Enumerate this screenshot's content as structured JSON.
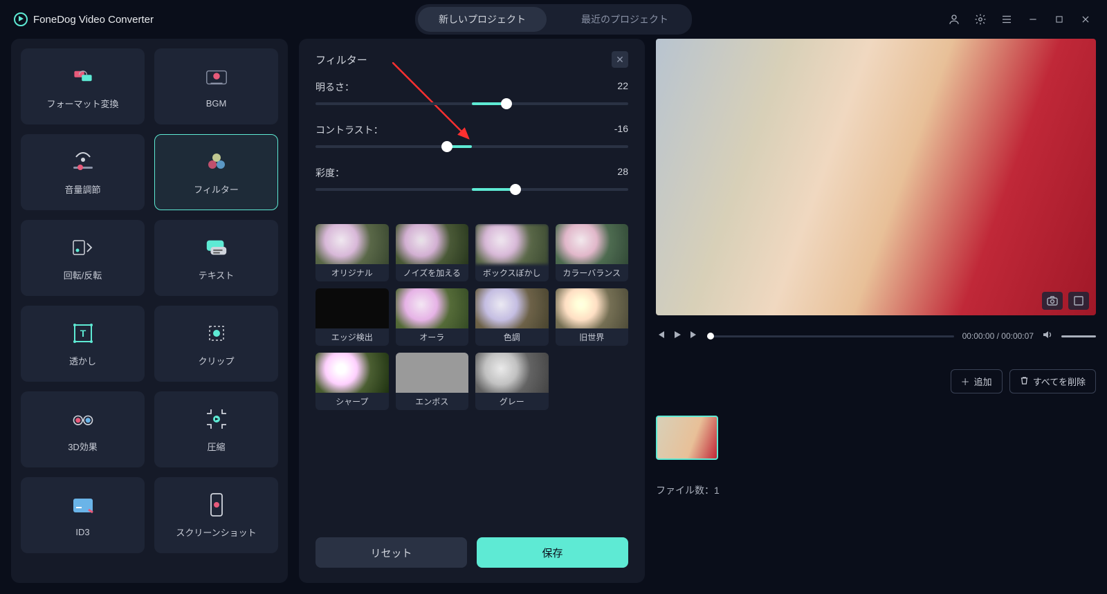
{
  "app": {
    "title": "FoneDog Video Converter"
  },
  "tabs": {
    "new": "新しいプロジェクト",
    "recent": "最近のプロジェクト"
  },
  "sidebar": {
    "items": [
      {
        "label": "フォーマット変換"
      },
      {
        "label": "BGM"
      },
      {
        "label": "音量調節"
      },
      {
        "label": "フィルター"
      },
      {
        "label": "回転/反転"
      },
      {
        "label": "テキスト"
      },
      {
        "label": "透かし"
      },
      {
        "label": "クリップ"
      },
      {
        "label": "3D効果"
      },
      {
        "label": "圧縮"
      },
      {
        "label": "ID3"
      },
      {
        "label": "スクリーンショット"
      }
    ]
  },
  "panel": {
    "title": "フィルター",
    "sliders": {
      "brightness": {
        "label": "明るさ：",
        "value": "22",
        "fill_start": 50,
        "fill_end": 61
      },
      "contrast": {
        "label": "コントラスト：",
        "value": "-16",
        "fill_start": 42,
        "fill_end": 50
      },
      "saturation": {
        "label": "彩度：",
        "value": "28",
        "fill_start": 50,
        "fill_end": 64
      }
    },
    "presets": [
      "オリジナル",
      "ノイズを加える",
      "ボックスぼかし",
      "カラーバランス",
      "エッジ検出",
      "オーラ",
      "色調",
      "旧世界",
      "シャープ",
      "エンボス",
      "グレー"
    ],
    "reset": "リセット",
    "save": "保存"
  },
  "player": {
    "time": "00:00:00 / 00:00:07"
  },
  "clips": {
    "add": "追加",
    "delete_all": "すべてを削除",
    "count_label": "ファイル数：1"
  }
}
